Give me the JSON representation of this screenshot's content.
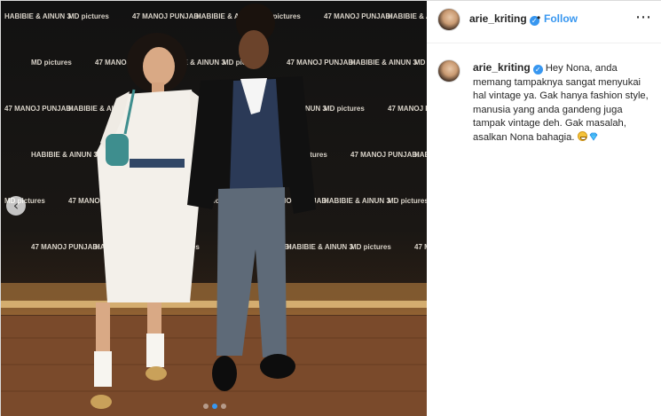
{
  "post": {
    "author": {
      "username": "arie_kriting",
      "verified": true,
      "follow_label": "Follow",
      "separator": "•"
    },
    "more_icon": "more-horizontal-icon",
    "photo": {
      "backdrop_logos": [
        "HABIBIE & AINUN 3",
        "MD pictures",
        "47 MANOJ PUNJABI"
      ],
      "carousel_prev_icon": "chevron-left-icon",
      "carousel_total": 3,
      "carousel_active": 2
    },
    "caption": {
      "username": "arie_kriting",
      "text": "Hey Nona, anda memang tampaknya sangat menyukai hal vintage ya. Gak hanya fashion style, manusia yang anda gandeng juga tampak vintage deh. Gak masalah, asalkan Nona bahagia.",
      "emojis": [
        "grinning-face-emoji",
        "gem-stone-emoji"
      ]
    },
    "colors": {
      "link_blue": "#3897f0",
      "text": "#262626",
      "border": "#dbdbdb"
    }
  }
}
